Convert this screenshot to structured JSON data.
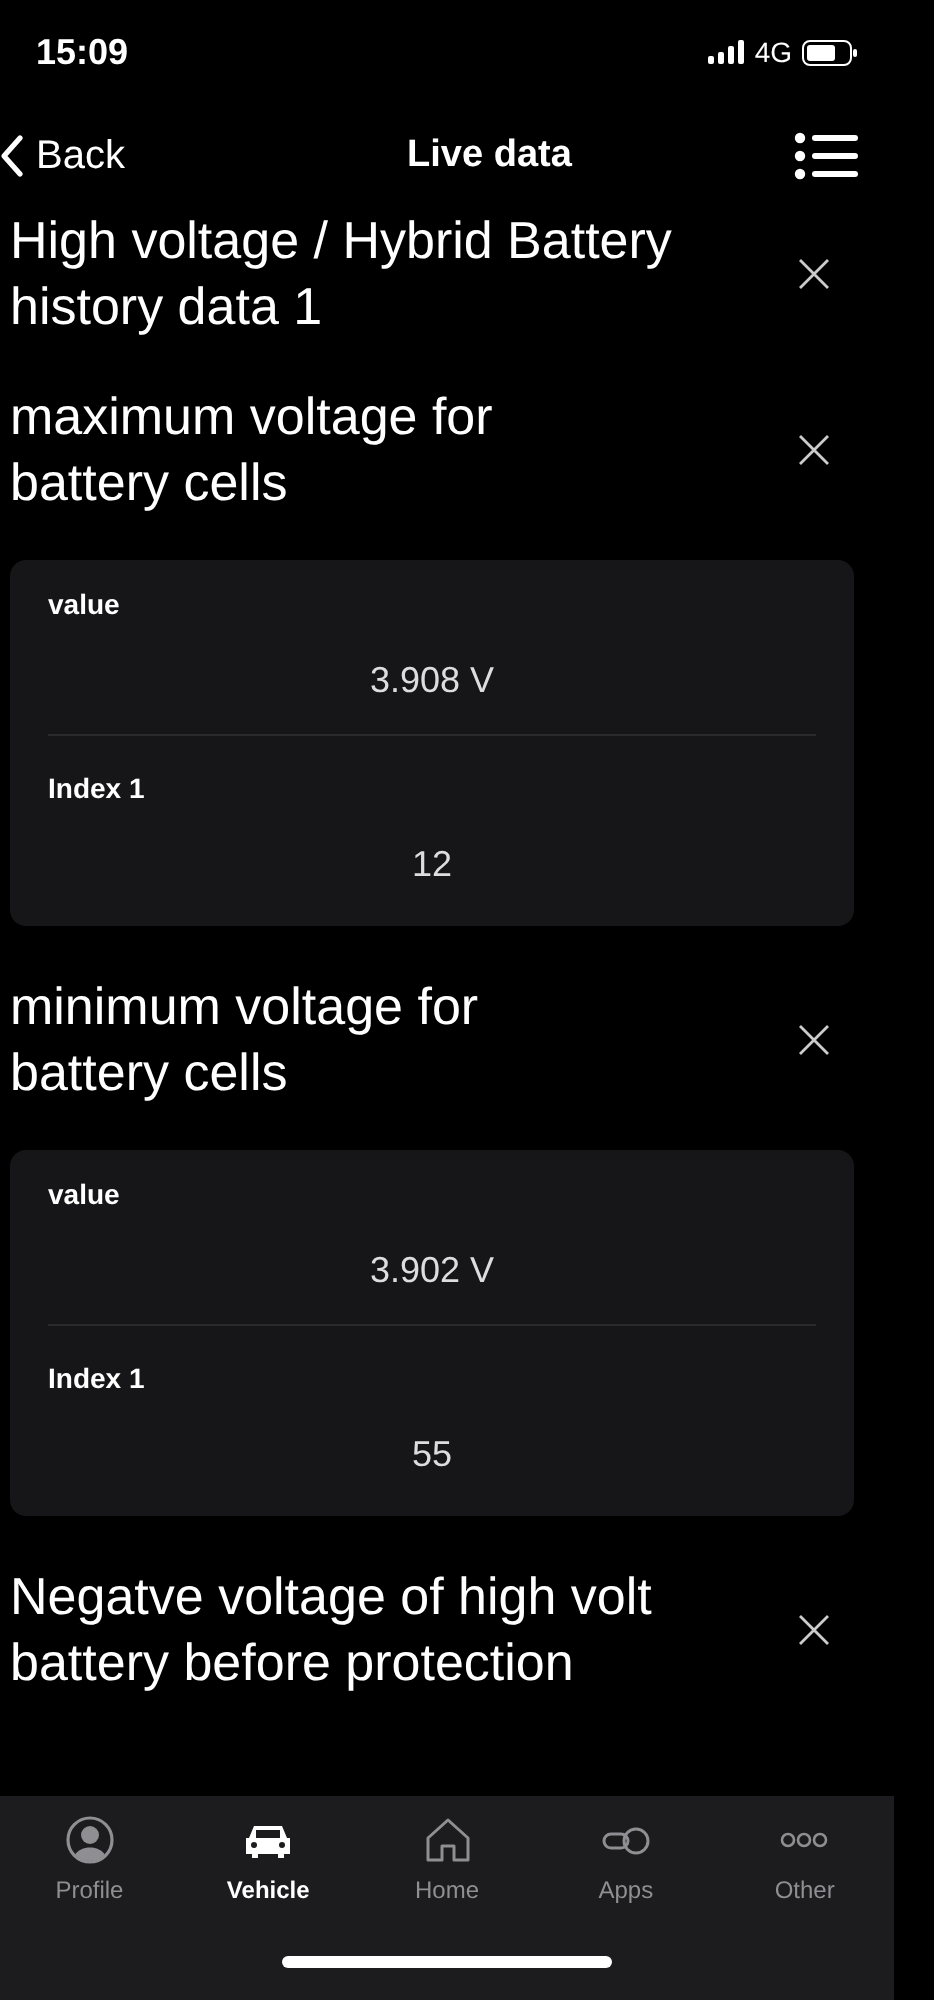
{
  "status_bar": {
    "time": "15:09",
    "network": "4G"
  },
  "nav": {
    "back": "Back",
    "title": "Live data"
  },
  "sections": [
    {
      "title": "High voltage / Hybrid Battery\nhistory data 1"
    },
    {
      "title": "maximum voltage for\nbattery cells",
      "rows": [
        {
          "label": "value",
          "value": "3.908 V"
        },
        {
          "label": "Index 1",
          "value": "12"
        }
      ]
    },
    {
      "title": "minimum voltage for\nbattery cells",
      "rows": [
        {
          "label": "value",
          "value": "3.902 V"
        },
        {
          "label": "Index 1",
          "value": "55"
        }
      ]
    },
    {
      "title": "Negatve voltage of high volt\nbattery before protection"
    }
  ],
  "tabs": [
    {
      "label": "Profile",
      "kind": "profile",
      "selected": false
    },
    {
      "label": "Vehicle",
      "kind": "vehicle",
      "selected": true
    },
    {
      "label": "Home",
      "kind": "home",
      "selected": false
    },
    {
      "label": "Apps",
      "kind": "apps",
      "selected": false
    },
    {
      "label": "Other",
      "kind": "other",
      "selected": false
    }
  ]
}
